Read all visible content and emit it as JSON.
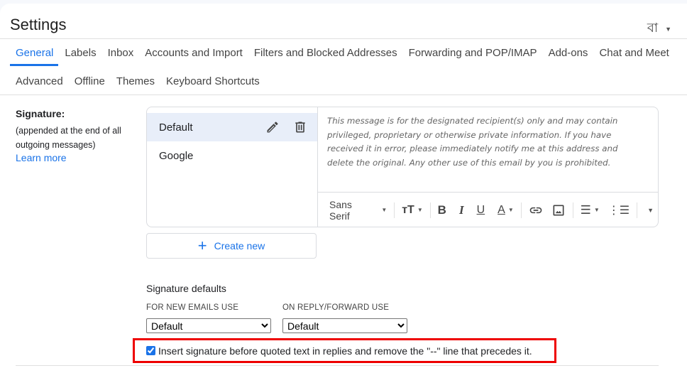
{
  "header": {
    "title": "Settings",
    "language_indicator": "বা"
  },
  "tabs": {
    "row1": [
      "General",
      "Labels",
      "Inbox",
      "Accounts and Import",
      "Filters and Blocked Addresses",
      "Forwarding and POP/IMAP",
      "Add-ons",
      "Chat and Meet"
    ],
    "row2": [
      "Advanced",
      "Offline",
      "Themes",
      "Keyboard Shortcuts"
    ],
    "active": "General"
  },
  "signature": {
    "label": "Signature:",
    "sublabel": "(appended at the end of all outgoing messages)",
    "learn_more": "Learn more",
    "items": [
      {
        "name": "Default",
        "selected": true
      },
      {
        "name": "Google",
        "selected": false
      }
    ],
    "content": "This message is for the designated recipient(s) only and may contain privileged, proprietary or otherwise private information. If you have received it in error, please immediately notify me at this address and delete the original. Any other use of this email by you is prohibited.",
    "toolbar": {
      "font": "Sans Serif",
      "icons": [
        "text-size-icon",
        "bold-icon",
        "italic-icon",
        "underline-icon",
        "text-color-icon",
        "link-icon",
        "image-icon",
        "align-icon",
        "numbered-list-icon",
        "more-icon"
      ]
    },
    "create_new": "Create new"
  },
  "defaults": {
    "heading": "Signature defaults",
    "new_emails_label": "FOR NEW EMAILS USE",
    "new_emails_value": "Default",
    "reply_label": "ON REPLY/FORWARD USE",
    "reply_value": "Default",
    "insert_before_quoted": {
      "checked": true,
      "label": "Insert signature before quoted text in replies and remove the \"--\" line that precedes it."
    }
  },
  "colors": {
    "accent": "#1a73e8",
    "highlight_box": "#ee0000",
    "selected_row": "#e8eef9"
  }
}
